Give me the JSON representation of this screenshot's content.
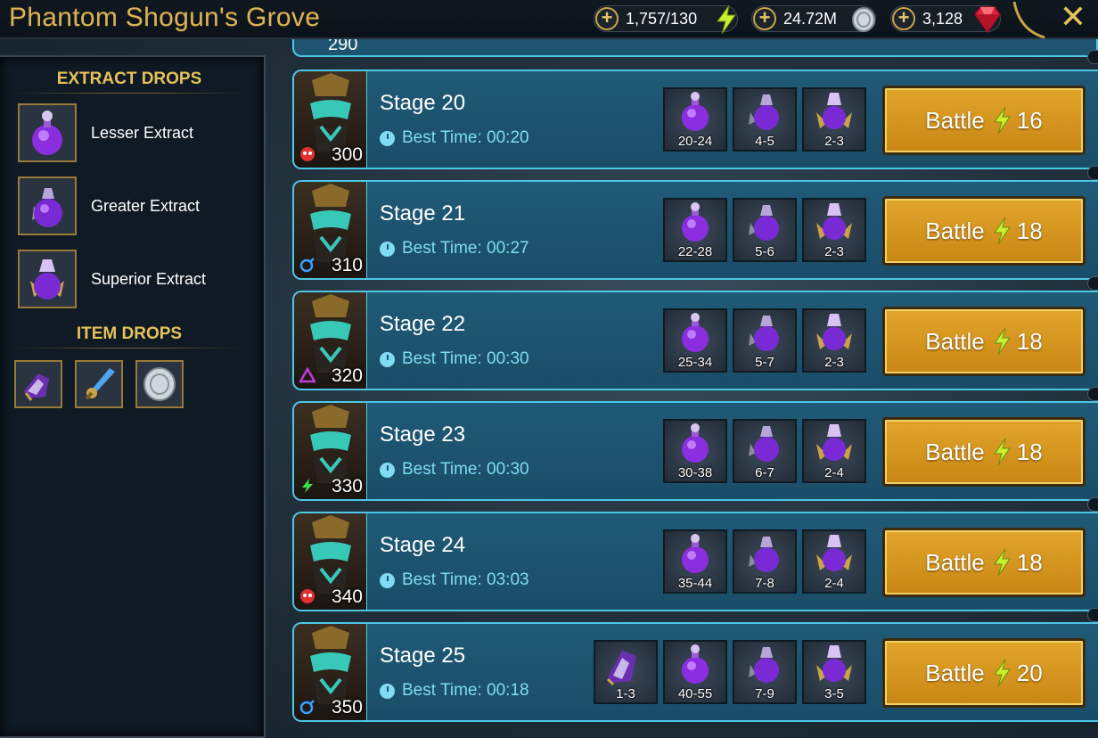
{
  "header": {
    "title": "Phantom Shogun's Grove",
    "energy": "1,757/130",
    "silver": "24.72M",
    "gems": "3,128"
  },
  "left_panel": {
    "extract_heading": "EXTRACT DROPS",
    "extracts": [
      {
        "name": "Lesser Extract",
        "icon": "lesser-extract-icon"
      },
      {
        "name": "Greater Extract",
        "icon": "greater-extract-icon"
      },
      {
        "name": "Superior Extract",
        "icon": "superior-extract-icon"
      }
    ],
    "item_heading": "ITEM DROPS",
    "items": [
      "artifact-icon",
      "weapon-icon",
      "silver-coin-icon"
    ]
  },
  "partial_stage_level": "290",
  "stages": [
    {
      "name": "Stage 20",
      "best_time": "Best Time: 00:20",
      "level": "300",
      "affinity": "force",
      "drops": [
        "20-24",
        "4-5",
        "2-3"
      ],
      "battle_label": "Battle",
      "energy_cost": "16"
    },
    {
      "name": "Stage 21",
      "best_time": "Best Time: 00:27",
      "level": "310",
      "affinity": "magic",
      "drops": [
        "22-28",
        "5-6",
        "2-3"
      ],
      "battle_label": "Battle",
      "energy_cost": "18"
    },
    {
      "name": "Stage 22",
      "best_time": "Best Time: 00:30",
      "level": "320",
      "affinity": "void",
      "drops": [
        "25-34",
        "5-7",
        "2-3"
      ],
      "battle_label": "Battle",
      "energy_cost": "18"
    },
    {
      "name": "Stage 23",
      "best_time": "Best Time: 00:30",
      "level": "330",
      "affinity": "spirit",
      "drops": [
        "30-38",
        "6-7",
        "2-4"
      ],
      "battle_label": "Battle",
      "energy_cost": "18"
    },
    {
      "name": "Stage 24",
      "best_time": "Best Time: 03:03",
      "level": "340",
      "affinity": "force",
      "drops": [
        "35-44",
        "7-8",
        "2-4"
      ],
      "battle_label": "Battle",
      "energy_cost": "18"
    },
    {
      "name": "Stage 25",
      "best_time": "Best Time: 00:18",
      "level": "350",
      "affinity": "magic",
      "artifact_drop": "1-3",
      "drops": [
        "40-55",
        "7-9",
        "3-5"
      ],
      "battle_label": "Battle",
      "energy_cost": "20"
    }
  ]
}
